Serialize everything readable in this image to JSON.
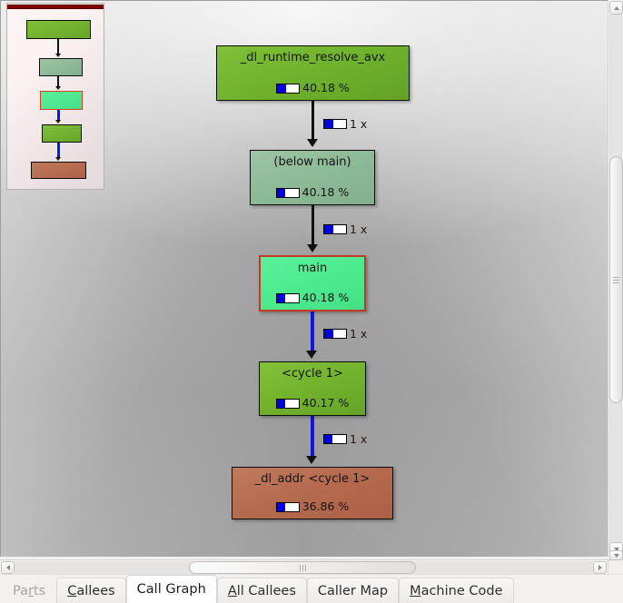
{
  "window": {
    "view_name": "Call Graph"
  },
  "graph": {
    "nodes": [
      {
        "id": "node-0",
        "label": "_dl_runtime_resolve_avx",
        "cost": "40.18 %",
        "cost_fraction": 0.4018,
        "fill": "#6fb22c",
        "border": "#0d0d0d",
        "selected": false
      },
      {
        "id": "node-1",
        "label": "(below main)",
        "cost": "40.18 %",
        "cost_fraction": 0.4018,
        "fill": "#8dba97",
        "border": "#0d0d0d",
        "selected": false
      },
      {
        "id": "node-2",
        "label": "main",
        "cost": "40.18 %",
        "cost_fraction": 0.4018,
        "fill": "#4deb90",
        "border": "#c03a27",
        "selected": true
      },
      {
        "id": "node-3",
        "label": "<cycle 1>",
        "cost": "40.17 %",
        "cost_fraction": 0.4017,
        "fill": "#72b32d",
        "border": "#0d0d0d",
        "selected": false
      },
      {
        "id": "node-4",
        "label": "_dl_addr <cycle 1>",
        "cost": "36.86 %",
        "cost_fraction": 0.3686,
        "fill": "#b56a4e",
        "border": "#0d0d0d",
        "selected": false
      }
    ],
    "edges": [
      {
        "from": "node-0",
        "to": "node-1",
        "label": "1 x",
        "call_fraction": 0.4,
        "color": "#111111"
      },
      {
        "from": "node-1",
        "to": "node-2",
        "label": "1 x",
        "call_fraction": 0.4,
        "color": "#111111"
      },
      {
        "from": "node-2",
        "to": "node-3",
        "label": "1 x",
        "call_fraction": 0.4,
        "color": "#1414e6"
      },
      {
        "from": "node-3",
        "to": "node-4",
        "label": "1 x",
        "call_fraction": 0.37,
        "color": "#1414e6"
      }
    ]
  },
  "overview": {
    "name": "birds-eye-overview",
    "viewport_color": "#800000",
    "mini_nodes": [
      {
        "fill": "#7fc039",
        "selected": false
      },
      {
        "fill": "#8dba97",
        "selected": false
      },
      {
        "fill": "#4deb90",
        "selected": true
      },
      {
        "fill": "#7fc039",
        "selected": false
      },
      {
        "fill": "#ad6045",
        "selected": false
      }
    ]
  },
  "scrollbars": {
    "vertical": {
      "up_arrow": "▲",
      "down_arrow": "▼",
      "thumb_position": 0.3
    },
    "horizontal": {
      "left_arrow": "◀",
      "right_arrow": "▶",
      "thumb_position": 0.45
    }
  },
  "tabs": [
    {
      "label": "Parts",
      "accel": "r",
      "active": false,
      "disabled": true
    },
    {
      "label": "Callees",
      "accel": "C",
      "active": false,
      "disabled": false
    },
    {
      "label": "Call Graph",
      "accel": "",
      "active": true,
      "disabled": false
    },
    {
      "label": "All Callees",
      "accel": "A",
      "active": false,
      "disabled": false
    },
    {
      "label": "Caller Map",
      "accel": "",
      "active": false,
      "disabled": false
    },
    {
      "label": "Machine Code",
      "accel": "M",
      "active": false,
      "disabled": false
    }
  ]
}
